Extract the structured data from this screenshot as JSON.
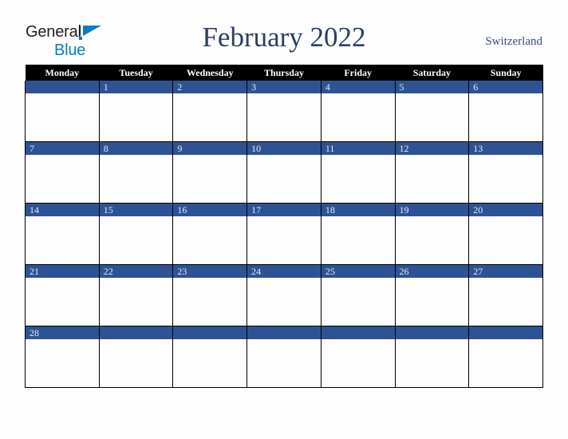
{
  "brand": {
    "line1": "General",
    "line2": "Blue",
    "mark": "triangle-logo",
    "color_dark": "#231f20",
    "color_blue": "#0c7cc0"
  },
  "header": {
    "title": "February 2022",
    "country": "Switzerland"
  },
  "calendar": {
    "colors": {
      "header_bg": "#000000",
      "header_text": "#ffffff",
      "daybar_bg": "#2e5395",
      "daybar_text": "#e8eaf0",
      "cell_bg": "#fdfdfd",
      "grid_line": "#000000"
    },
    "weekday_headers": [
      "Monday",
      "Tuesday",
      "Wednesday",
      "Thursday",
      "Friday",
      "Saturday",
      "Sunday"
    ],
    "weeks": [
      {
        "days": [
          "",
          "1",
          "2",
          "3",
          "4",
          "5",
          "6"
        ]
      },
      {
        "days": [
          "7",
          "8",
          "9",
          "10",
          "11",
          "12",
          "13"
        ]
      },
      {
        "days": [
          "14",
          "15",
          "16",
          "17",
          "18",
          "19",
          "20"
        ]
      },
      {
        "days": [
          "21",
          "22",
          "23",
          "24",
          "25",
          "26",
          "27"
        ]
      },
      {
        "days": [
          "28",
          "",
          "",
          "",
          "",
          "",
          ""
        ]
      }
    ]
  }
}
